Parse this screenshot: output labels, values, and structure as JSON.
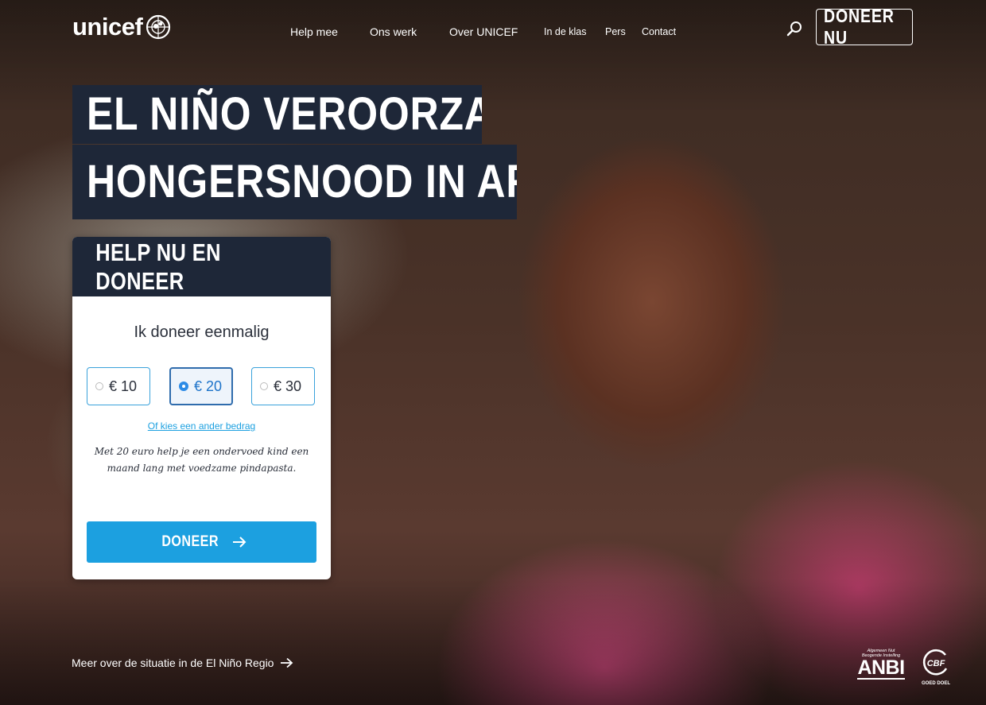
{
  "header": {
    "logo_text": "unicef",
    "nav": [
      {
        "label": "Help mee"
      },
      {
        "label": "Ons werk"
      },
      {
        "label": "Over UNICEF"
      },
      {
        "label": "In de klas"
      },
      {
        "label": "Pers"
      },
      {
        "label": "Contact"
      }
    ],
    "donate_button": "DONEER NU"
  },
  "hero": {
    "title_line_1": "EL NIÑO VEROORZAAKT",
    "title_line_2": "HONGERSNOOD IN AFRIKA"
  },
  "donate_card": {
    "heading": "HELP NU EN DONEER",
    "subheading": "Ik doneer eenmalig",
    "amounts": [
      {
        "label": "€ 10",
        "selected": false
      },
      {
        "label": "€ 20",
        "selected": true
      },
      {
        "label": "€ 30",
        "selected": false
      }
    ],
    "other_amount_link": "Of kies een ander bedrag",
    "note": "Met 20 euro help je een ondervoed kind een maand lang met voedzame pindapasta.",
    "submit_label": "DONEER"
  },
  "footer": {
    "more_link": "Meer over de situatie in de El Niño Regio",
    "anbi": {
      "small_text": "Algemeen Nut Beogende Instelling",
      "label": "ANBI"
    },
    "cbf": {
      "label": "CBF",
      "sub": "GOED DOEL"
    }
  },
  "colors": {
    "navy": "#1e2738",
    "accent_blue": "#1ca0e0",
    "selected_blue": "#2f6cad"
  },
  "icons": [
    "unicef-emblem-icon",
    "search-icon",
    "arrow-right-icon"
  ]
}
